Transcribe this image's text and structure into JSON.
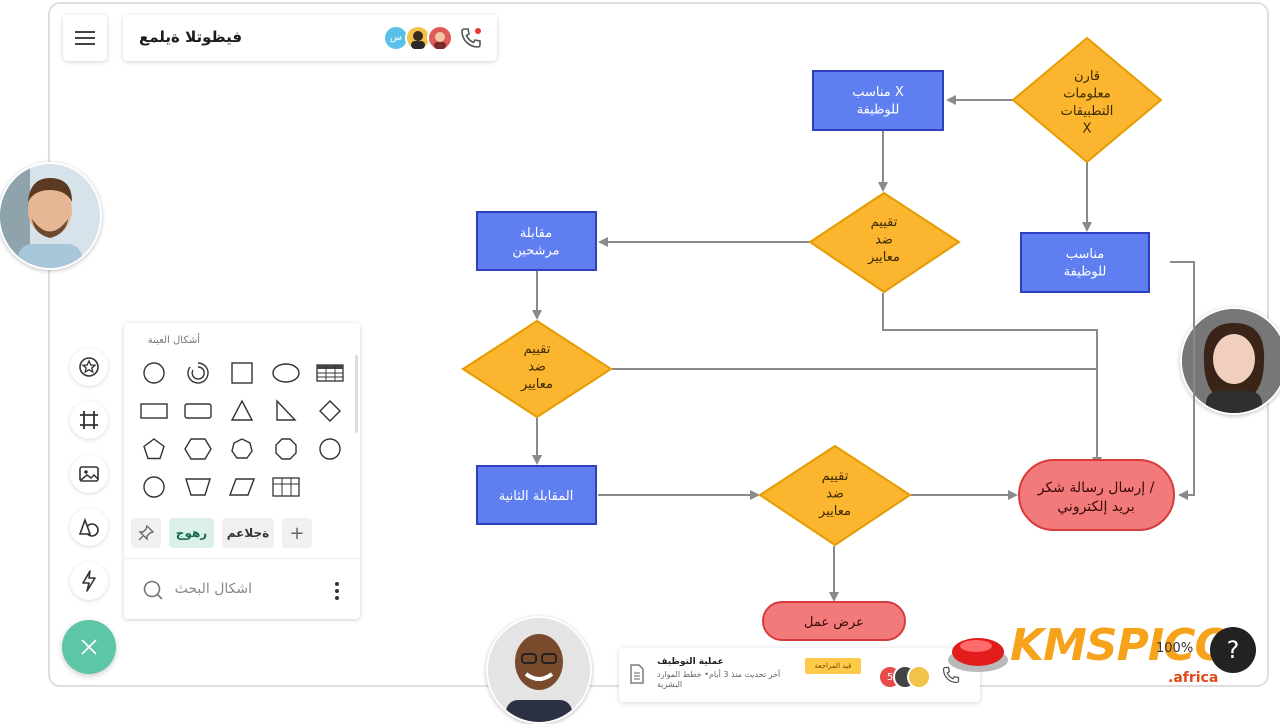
{
  "app": {
    "doc_title": "فيظوتلا ةيلمع",
    "avatar_initial": "س"
  },
  "panel": {
    "title": "أشكال العينة",
    "tags": [
      {
        "label": "رهوج"
      },
      {
        "label": "ةجلاعم"
      }
    ],
    "add_label": "+",
    "search_placeholder": "اشكال البحث"
  },
  "flowchart": {
    "nodes": {
      "compare_apps": "قارن\nمعلومات\nالتطبيقات\nX",
      "suitable_x": "مناسب X\nللوظيفة",
      "evaluate_1": "تقييم\nضد\nمعايير",
      "interview_candidates": "مقابلة\nمرشحين",
      "suitable_job": "مناسب\nللوظيفة",
      "evaluate_2": "تقييم\nضد\nمعايير",
      "send_thanks": "إرسال رسالة شكر /\nبريد إلكتروني",
      "second_interview": "المقابلة الثانية",
      "evaluate_3": "تقييم\nضد\nمعايير",
      "job_offer": "عرض عمل"
    }
  },
  "footer": {
    "title": "عملية التوظيف",
    "subtitle": "آخر تحديث منذ 3 أيام• خطط الموارد البشرية",
    "badge": "قيد المراجعة",
    "count": "5"
  },
  "zoom": "100%",
  "help": "?",
  "watermark": {
    "brand": "KMSPICO",
    "suffix": ".africa"
  },
  "colors": {
    "blue_fill": "#5f7ff0",
    "blue_stroke": "#2f3fbf",
    "yellow_fill": "#fbb52e",
    "yellow_stroke": "#e59c00",
    "red_fill": "#f27a7a",
    "red_stroke": "#d63c3c",
    "connector": "#8a8a8a",
    "fab": "#5cc6a7"
  }
}
